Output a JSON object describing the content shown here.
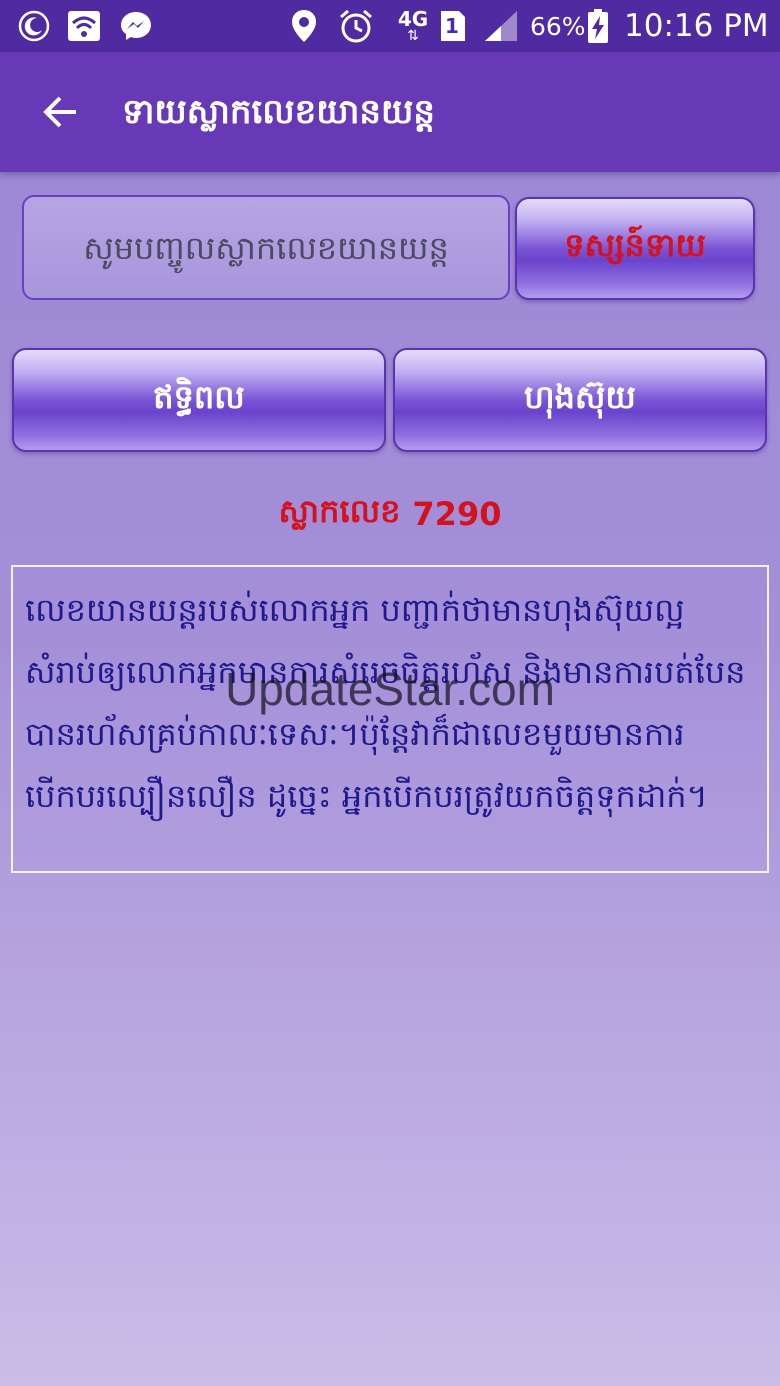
{
  "status_bar": {
    "icons": [
      "moon-icon",
      "wifi-icon",
      "messenger-icon",
      "location-icon",
      "alarm-icon",
      "network-4g-icon",
      "sim-1-icon",
      "signal-icon",
      "battery-charging-icon"
    ],
    "network_type": "4G",
    "sim_slot": "1",
    "battery": "66%",
    "time": "10:16 PM"
  },
  "app_bar": {
    "title": "ទាយស្លាកលេខយានយន្ត"
  },
  "search": {
    "placeholder": "សូមបញ្ចូលស្លាកលេខយានយន្ត",
    "value": "",
    "predict_label": "ទស្សន៍ទាយ"
  },
  "categories": {
    "wealth_label": "ឥទ្ធិពល",
    "luck_label": "ហុងស៊ុយ"
  },
  "result": {
    "plate_label": "ស្លាកលេខ",
    "plate_number": "7290",
    "description": "លេខយានយន្តរបស់លោកអ្នក បញ្ជាក់ថាមានហុងស៊ុយល្អ សំរាប់ឲ្យលោកអ្នកមានការសំរេចចិត្តរហ័ស និងមានការបត់បែនបានរហ័សគ្រប់កាលៈទេសៈ។ប៉ុន្តែវាក៏ជាលេខមួយមានការបើកបរល្បឿនលឿន ដូច្នេះ អ្នកបើកបរត្រូវយកចិត្តទុកដាក់។"
  },
  "watermark": "UpdateStar.com",
  "colors": {
    "status_bar": "#4f2aa0",
    "app_bar": "#6739b6",
    "accent_red": "#d4121e",
    "text_blue": "#1e1a8c"
  }
}
